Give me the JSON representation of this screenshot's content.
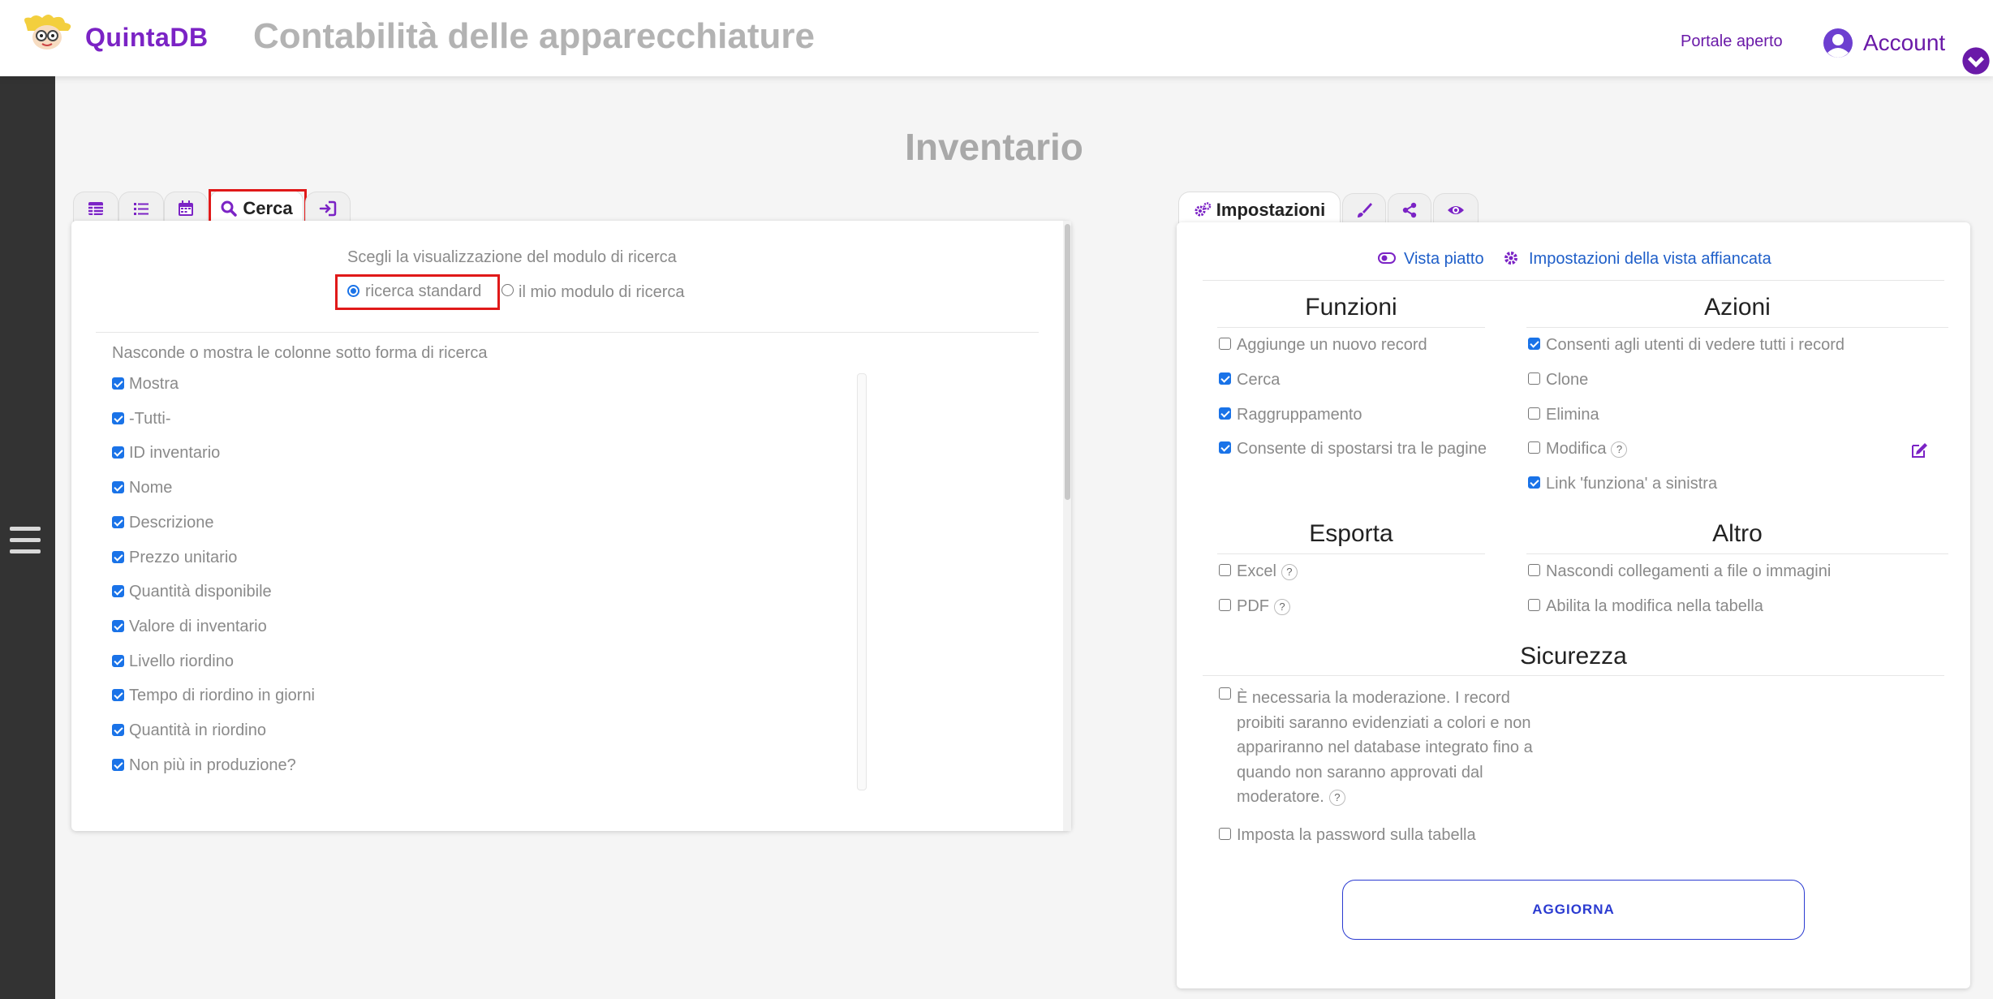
{
  "header": {
    "logo_text": "QuintaDB",
    "app_title": "Contabilità delle apparecchiature",
    "portal_link": "Portale aperto",
    "account_label": "Account"
  },
  "page": {
    "title": "Inventario"
  },
  "left_tabs": [
    {
      "icon": "table-icon"
    },
    {
      "icon": "list-icon"
    },
    {
      "icon": "calendar-icon"
    },
    {
      "icon": "search-icon",
      "label": "Cerca",
      "active": true
    },
    {
      "icon": "sign-in-icon"
    }
  ],
  "search_form": {
    "prompt": "Scegli la visualizzazione del modulo di ricerca",
    "option_standard": "ricerca standard",
    "option_custom": "il mio modulo di ricerca",
    "selected": "standard",
    "columns_heading": "Nasconde o mostra le colonne sotto forma di ricerca",
    "columns": [
      {
        "label": "Mostra",
        "checked": true
      },
      {
        "label": "-Tutti-",
        "checked": true
      },
      {
        "label": "ID inventario",
        "checked": true
      },
      {
        "label": "Nome",
        "checked": true
      },
      {
        "label": "Descrizione",
        "checked": true
      },
      {
        "label": "Prezzo unitario",
        "checked": true
      },
      {
        "label": "Quantità disponibile",
        "checked": true
      },
      {
        "label": "Valore di inventario",
        "checked": true
      },
      {
        "label": "Livello riordino",
        "checked": true
      },
      {
        "label": "Tempo di riordino in giorni",
        "checked": true
      },
      {
        "label": "Quantità in riordino",
        "checked": true
      },
      {
        "label": "Non più in produzione?",
        "checked": true
      }
    ]
  },
  "right_tabs": [
    {
      "icon": "cogs-icon",
      "label": "Impostazioni",
      "active": true
    },
    {
      "icon": "brush-icon"
    },
    {
      "icon": "share-icon"
    },
    {
      "icon": "eye-icon"
    }
  ],
  "settings": {
    "vista_piatto": "Vista piatto",
    "vista_affiancata": "Impostazioni della vista affiancata",
    "funzioni": {
      "title": "Funzioni",
      "items": [
        {
          "label": "Aggiunge un nuovo record",
          "checked": false
        },
        {
          "label": "Cerca",
          "checked": true
        },
        {
          "label": "Raggruppamento",
          "checked": true
        },
        {
          "label": "Consente di spostarsi tra le pagine",
          "checked": true
        }
      ]
    },
    "azioni": {
      "title": "Azioni",
      "items": [
        {
          "label": "Consenti agli utenti di vedere tutti i record",
          "checked": true
        },
        {
          "label": "Clone",
          "checked": false
        },
        {
          "label": "Elimina",
          "checked": false
        },
        {
          "label": "Modifica",
          "checked": false,
          "help": "?"
        },
        {
          "label": "Link 'funziona' a sinistra",
          "checked": true
        }
      ]
    },
    "esporta": {
      "title": "Esporta",
      "items": [
        {
          "label": "Excel",
          "checked": false,
          "help": "?"
        },
        {
          "label": "PDF",
          "checked": false,
          "help": "?"
        }
      ]
    },
    "altro": {
      "title": "Altro",
      "items": [
        {
          "label": "Nascondi collegamenti a file o immagini",
          "checked": false
        },
        {
          "label": "Abilita la modifica nella tabella",
          "checked": false
        }
      ]
    },
    "sicurezza": {
      "title": "Sicurezza",
      "moderation_lines": [
        "È necessaria la moderazione. I record",
        "proibiti saranno evidenziati a colori e non",
        "appariranno nel database integrato fino a",
        "quando non saranno approvati dal",
        "moderatore."
      ],
      "moderation_checked": false,
      "moderation_help": "?",
      "password": "Imposta la password sulla tabella",
      "password_checked": false
    },
    "update_button": "AGGIORNA"
  },
  "colors": {
    "brand": "#7b23c5",
    "accent_link": "#1f5fc9",
    "highlight_box": "#e01919",
    "sidebar": "#333333",
    "update_button": "#2b3bd1"
  }
}
